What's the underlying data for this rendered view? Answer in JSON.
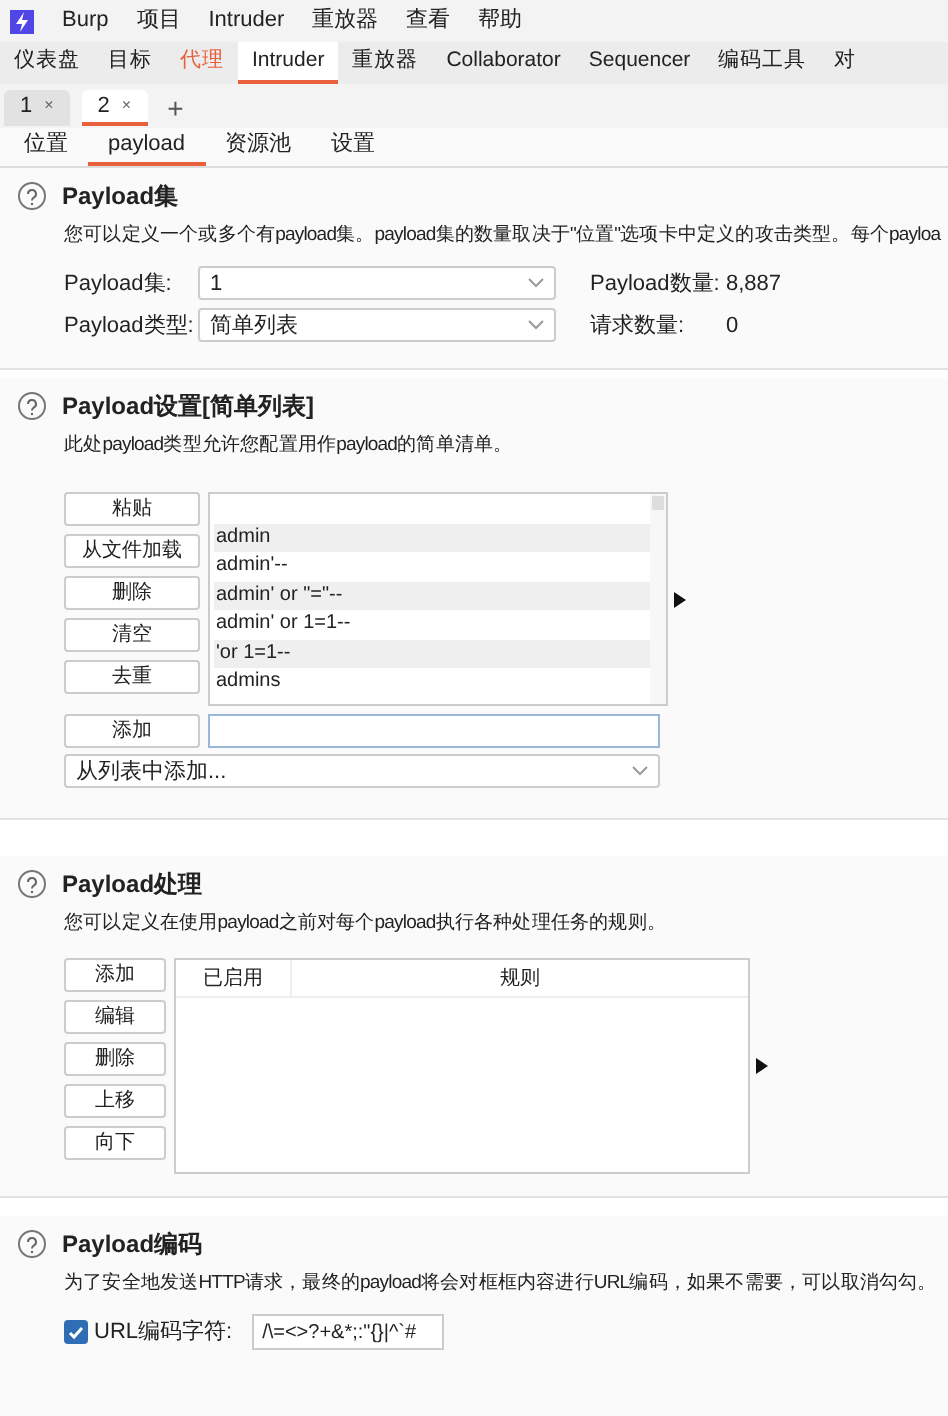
{
  "menu": [
    "Burp",
    "项目",
    "Intruder",
    "重放器",
    "查看",
    "帮助"
  ],
  "main_tabs": [
    {
      "label": "仪表盘",
      "selected": false,
      "highlighted": false
    },
    {
      "label": "目标",
      "selected": false,
      "highlighted": false
    },
    {
      "label": "代理",
      "selected": false,
      "highlighted": true
    },
    {
      "label": "Intruder",
      "selected": true,
      "highlighted": false
    },
    {
      "label": "重放器",
      "selected": false,
      "highlighted": false
    },
    {
      "label": "Collaborator",
      "selected": false,
      "highlighted": false
    },
    {
      "label": "Sequencer",
      "selected": false,
      "highlighted": false
    },
    {
      "label": "编码工具",
      "selected": false,
      "highlighted": false
    },
    {
      "label": "对",
      "selected": false,
      "highlighted": false
    }
  ],
  "attack_tabs": [
    {
      "label": "1",
      "close": "×",
      "selected": false
    },
    {
      "label": "2",
      "close": "×",
      "selected": true
    }
  ],
  "new_tab": "+",
  "sub_tabs": [
    {
      "label": "位置",
      "selected": false
    },
    {
      "label": "payload",
      "selected": true
    },
    {
      "label": "资源池",
      "selected": false
    },
    {
      "label": "设置",
      "selected": false
    }
  ],
  "payload_sets": {
    "title": "Payload集",
    "description": "您可以定义一个或多个有payload集。payload集的数量取决于\"位置\"选项卡中定义的攻击类型。每个payloa",
    "set_label": "Payload集:",
    "set_value": "1",
    "type_label": "Payload类型:",
    "type_value": "简单列表",
    "count_label": "Payload数量:",
    "count_value": "8,887",
    "requests_label": "请求数量:",
    "requests_value": "0"
  },
  "payload_settings": {
    "title": "Payload设置[简单列表]",
    "description": "此处payload类型允许您配置用作payload的简单清单。",
    "buttons": [
      "粘贴",
      "从文件加载",
      "删除",
      "清空",
      "去重"
    ],
    "items": [
      "admin",
      "admin'--",
      "admin' or \"=\"--",
      "admin' or 1=1--",
      "'or 1=1--",
      "admins"
    ],
    "add_button": "添加",
    "add_from_list": "从列表中添加..."
  },
  "payload_processing": {
    "title": "Payload处理",
    "description": "您可以定义在使用payload之前对每个payload执行各种处理任务的规则。",
    "buttons": [
      "添加",
      "编辑",
      "删除",
      "上移",
      "向下"
    ],
    "columns": [
      "已启用",
      "规则"
    ]
  },
  "payload_encoding": {
    "title": "Payload编码",
    "description": "为了安全地发送HTTP请求，最终的payload将会对框框内容进行URL编码，如果不需要，可以取消勾勾。",
    "checkbox_label": "URL编码字符:",
    "checked": true,
    "chars": "/\\=<>?+&*;:\"{}|^`#"
  }
}
